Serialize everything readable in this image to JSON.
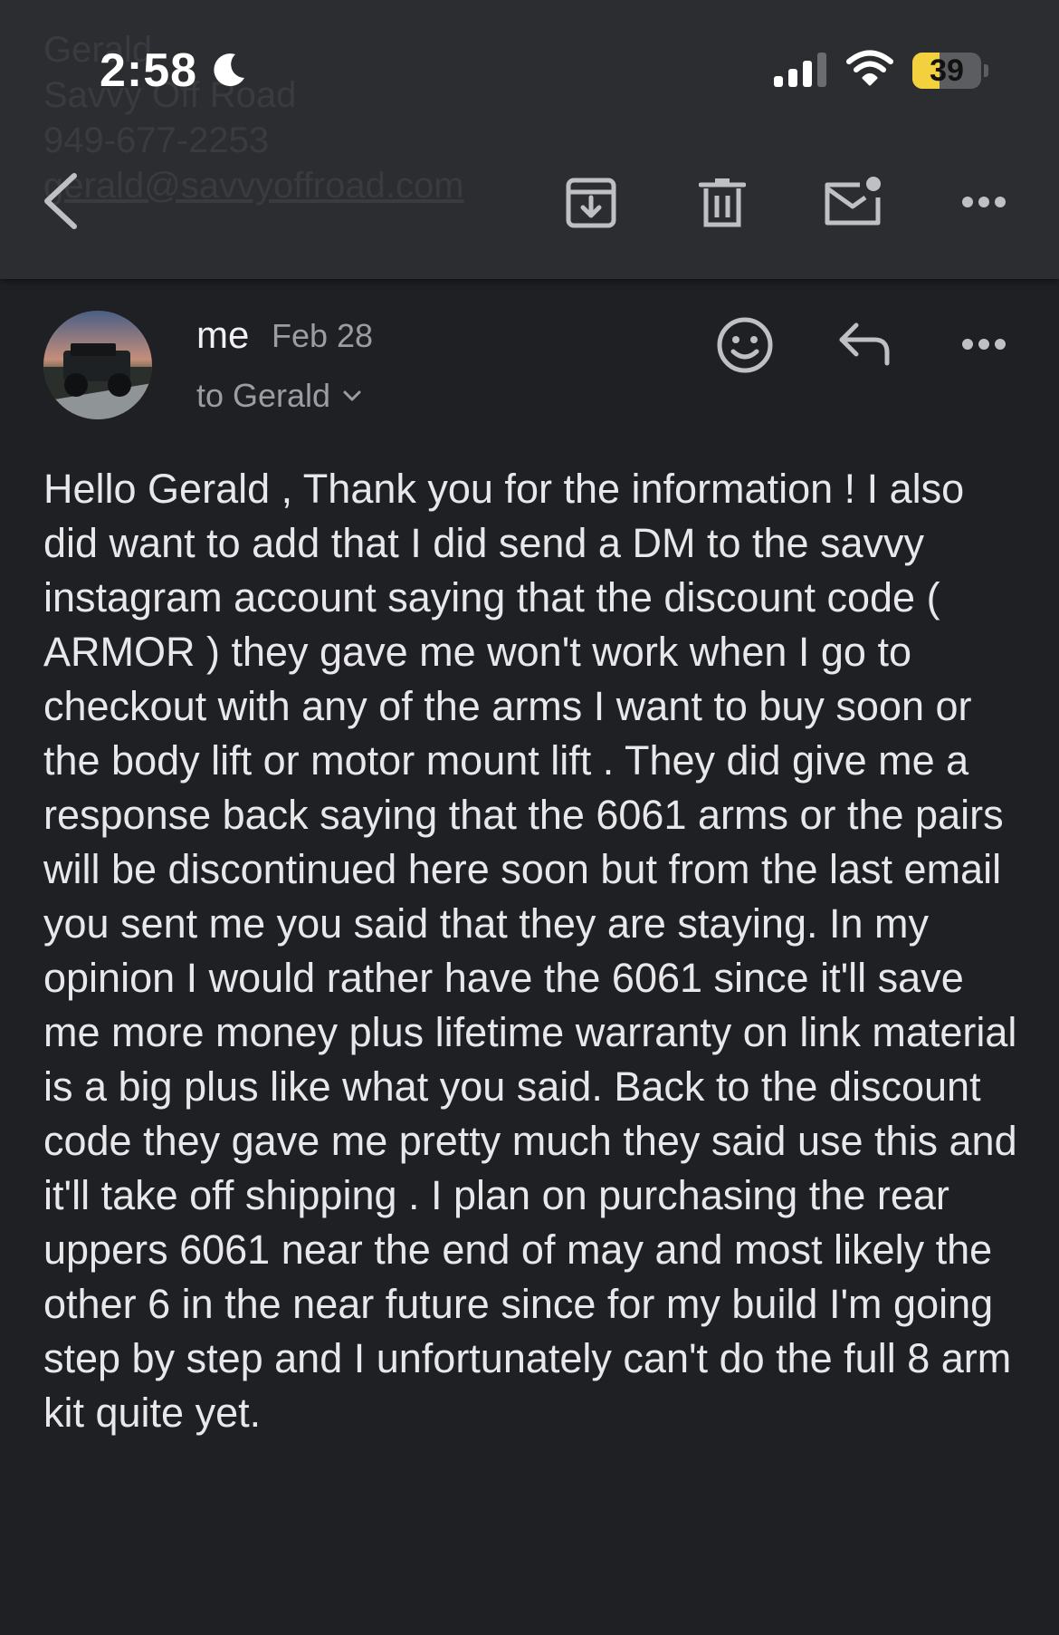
{
  "status_bar": {
    "time": "2:58",
    "battery_percent": "39",
    "battery_level": 0.39,
    "icons": [
      "moon-icon",
      "signal-icon",
      "wifi-icon",
      "battery-icon"
    ]
  },
  "background_text": {
    "lines": [
      "Gerald",
      "Savvy Off Road",
      "949-677-2253",
      "gerald@savvyoffroad.com"
    ]
  },
  "toolbar": {
    "icons": [
      "back-icon",
      "archive-icon",
      "trash-icon",
      "mark-unread-icon",
      "more-icon"
    ]
  },
  "email": {
    "sender": "me",
    "date": "Feb 28",
    "recipient": "to Gerald",
    "actions": [
      "emoji-reaction-icon",
      "reply-icon",
      "more-icon"
    ],
    "body": "Hello Gerald , Thank you for the information ! I also did want to add that I did send a DM to the savvy instagram account saying that the discount code ( ARMOR ) they gave me won't work when I go to checkout with any of the arms I want to buy soon or the body lift or motor mount lift . They did give me a response back saying that the 6061 arms or the pairs will be discontinued here soon but from the last email you sent me you said that they are staying. In my opinion I would rather have the 6061 since it'll save me more money plus lifetime warranty on link material is a big plus like what you said. Back to the discount code they gave me pretty much they said use this and it'll take off shipping . I plan on purchasing the rear uppers 6061 near the end of may and most likely the other 6 in the near future since for my build I'm going step by step and I unfortunately can't do the full 8 arm kit quite yet."
  },
  "colors": {
    "background": "#1f2024",
    "toolbar": "#2c2d31",
    "battery_accent": "#f3d03e",
    "icon": "#bfc0c4"
  }
}
